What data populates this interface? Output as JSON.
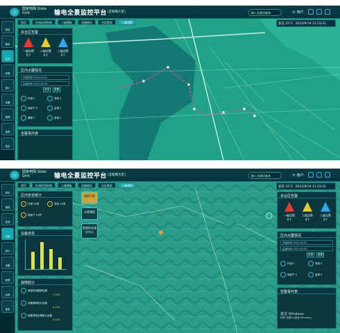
{
  "app": {
    "logo_text": "国家电网 State Grid",
    "title": "输电全景监控平台",
    "subtitle": "(互联网大区)",
    "search_placeholder": "输入关键词查询",
    "user": "tr 用户"
  },
  "sidebar": {
    "items": [
      {
        "label": "首页"
      },
      {
        "label": "输电"
      },
      {
        "label": "监测"
      },
      {
        "label": "告警"
      },
      {
        "label": "统计"
      },
      {
        "label": "设置"
      },
      {
        "label": "管理"
      },
      {
        "label": "运维"
      },
      {
        "label": "更多"
      }
    ]
  },
  "breadcrumbs1": [
    "首页",
    "在线检测系统",
    "二维模板",
    "设备概况",
    "台区概览",
    "三维视图"
  ],
  "breadcrumbs2": [
    "首页",
    "在线检测系统",
    "二维模板",
    "设备概况",
    "台区概览",
    "三维视图"
  ],
  "weather1": {
    "text": "多云 25°C",
    "datetime": "2022/9/19 11:53:31"
  },
  "weather2": {
    "text": "多云 25°C",
    "datetime": "2022/9/19 11:53:31"
  },
  "panel_alarm": {
    "title": "本台区告警",
    "items": [
      {
        "label": "一级告警",
        "count": "0个",
        "color": "#e83a2e"
      },
      {
        "label": "二级告警",
        "count": "0个",
        "color": "#e8c92e"
      },
      {
        "label": "三级告警",
        "count": "0个",
        "color": "#2ea8e8"
      }
    ]
  },
  "panel_query": {
    "title": "区内大厦情况",
    "fields": [
      "开始时间  2022-09-01",
      "结束时间  2022-09-30"
    ],
    "buttons": [
      "查询",
      "重置"
    ],
    "stats": [
      {
        "label": "杆塔",
        "value": "0"
      },
      {
        "label": "导线",
        "value": "0"
      },
      {
        "label": "绝缘子",
        "value": "0"
      },
      {
        "label": "金具",
        "value": "0"
      },
      {
        "label": "基础",
        "value": "0"
      },
      {
        "label": "其他",
        "value": "0"
      }
    ]
  },
  "panel_events": {
    "title": "告警事件表"
  },
  "panel_status": {
    "title": "设备状态"
  },
  "panel_stats2": {
    "title": "区内安全统计",
    "items": [
      "杆塔 20项",
      "导线 14项",
      "绝缘子 12项"
    ]
  },
  "panel_fault": {
    "title": "故障统计",
    "items": [
      {
        "label": "局部放电跟踪结果",
        "value": "2.50%"
      },
      {
        "label": "设备故障统计结果",
        "value": "6.40%"
      },
      {
        "label": "隐患排除处理统计结果",
        "value": "0.00%"
      }
    ]
  },
  "map_chips": [
    "预报气象",
    "灾害预报",
    "智能防灾减灾中心"
  ],
  "windows_notice": {
    "line1": "激活 Windows",
    "line2": "转到\"设置\"以激活 Windows。"
  },
  "chart_bars": {
    "values": [
      60,
      92,
      70,
      40
    ]
  }
}
